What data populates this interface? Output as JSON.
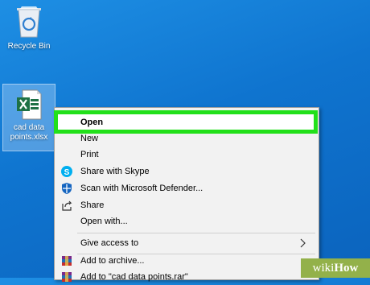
{
  "desktop": {
    "icons": [
      {
        "label": "Recycle Bin"
      },
      {
        "label_line1": "cad data",
        "label_line2": "points.xlsx"
      }
    ]
  },
  "context_menu": {
    "items": [
      {
        "label": "Open",
        "bold": true,
        "icon": null
      },
      {
        "label": "New",
        "icon": null
      },
      {
        "label": "Print",
        "icon": null
      },
      {
        "label": "Share with Skype",
        "icon": "skype-icon"
      },
      {
        "label": "Scan with Microsoft Defender...",
        "icon": "defender-icon"
      },
      {
        "label": "Share",
        "icon": "share-icon"
      },
      {
        "label": "Open with...",
        "icon": null
      },
      {
        "label": "Give access to",
        "icon": null,
        "submenu": true
      },
      {
        "label": "Add to archive...",
        "icon": "winrar-icon"
      },
      {
        "label": "Add to \"cad data points.rar\"",
        "icon": "winrar-icon"
      }
    ]
  },
  "watermark": {
    "part1": "wiki",
    "part2": "How"
  },
  "colors": {
    "desktop_blue": "#0f74cf",
    "highlight_green": "#22e01a",
    "menu_bg": "#f2f2f2",
    "excel_green": "#1e7145",
    "wikihow_green": "#93b14a"
  }
}
